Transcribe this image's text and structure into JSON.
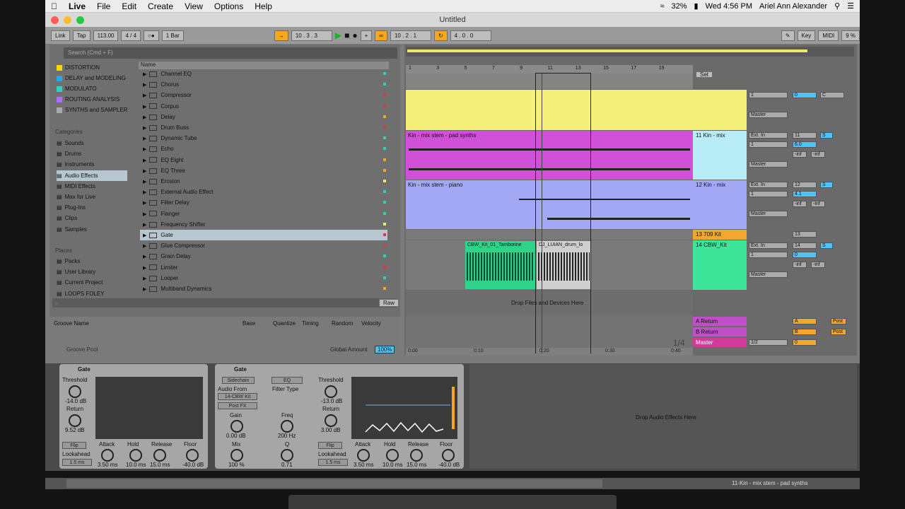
{
  "menubar": {
    "app": "Live",
    "items": [
      "File",
      "Edit",
      "Create",
      "View",
      "Options",
      "Help"
    ],
    "battery": "32%",
    "clock": "Wed 4:56 PM",
    "user": "Ariel Ann Alexander"
  },
  "window": {
    "title": "Untitled"
  },
  "transport": {
    "link": "Link",
    "tap": "Tap",
    "tempo": "113.00",
    "signature": "4 / 4",
    "quantize": "1 Bar",
    "position": "10 .  3 .  3",
    "loop_start": "10 .  2 .  1",
    "loop_length": "4 .  0 .  0",
    "key": "Key",
    "midi": "MIDI",
    "cpu": "9 %"
  },
  "browser": {
    "search_placeholder": "Search (Cmd + F)",
    "collections": [
      {
        "label": "DISTORTION",
        "color": "#f5d800"
      },
      {
        "label": "DELAY and MODELING",
        "color": "#29a7e0"
      },
      {
        "label": "MODULATO",
        "color": "#2ed0c0"
      },
      {
        "label": "ROUTING ANALYSIS",
        "color": "#b06cff"
      },
      {
        "label": "SYNTHS and SAMPLER",
        "color": "#aaaaaa"
      }
    ],
    "categories_header": "Categories",
    "categories": [
      "Sounds",
      "Drums",
      "Instruments",
      "Audio Effects",
      "MIDI Effects",
      "Max for Live",
      "Plug-Ins",
      "Clips",
      "Samples"
    ],
    "places_header": "Places",
    "places": [
      "Packs",
      "User Library",
      "Current Project",
      "LOOPS FOLEY"
    ],
    "name_header": "Name",
    "items": [
      "Channel EQ",
      "Chorus",
      "Compressor",
      "Corpus",
      "Delay",
      "Drum Buss",
      "Dynamic Tube",
      "Echo",
      "EQ Eight",
      "EQ Three",
      "Erosion",
      "External Audio Effect",
      "Filter Delay",
      "Flanger",
      "Frequency Shifter",
      "Gate",
      "Glue Compressor",
      "Grain Delay",
      "Limiter",
      "Looper",
      "Multiband Dynamics"
    ],
    "raw": "Raw"
  },
  "groove": {
    "columns": [
      "Groove Name",
      "Base",
      "Quantize",
      "Timing",
      "Random",
      "Velocity"
    ],
    "pool": "Groove Pool",
    "global_amount_label": "Global Amount",
    "global_amount": "100%"
  },
  "arrangement": {
    "ruler": [
      "1",
      "3",
      "5",
      "7",
      "9",
      "11",
      "13",
      "15",
      "17",
      "19"
    ],
    "time": [
      "0:00",
      "0:10",
      "0:20",
      "0:30",
      "0:40"
    ],
    "set": "Set",
    "zoom": "1/4",
    "drop_hint": "Drop Files and Devices Here",
    "clips": {
      "pad": "Kin - mix stem - pad synths",
      "piano": "Kin - mix stem - piano",
      "tamb": "CBW_Kit_01_Tamborine",
      "drum": "DJ_LUIAN_drum_lo"
    },
    "tracks": [
      {
        "name": "11 Kin - mix",
        "num": "11",
        "vol": "6.0",
        "input": "Ext. In",
        "ch": "1",
        "out": "Master"
      },
      {
        "name": "12 Kin - mix",
        "num": "12",
        "vol": "4.1",
        "input": "Ext. In",
        "ch": "1",
        "out": "Master"
      },
      {
        "name": "13 709 Kit",
        "num": "13"
      },
      {
        "name": "14 CBW_Kit",
        "num": "14",
        "vol": "0",
        "input": "Ext. In",
        "ch": "1",
        "out": "Master"
      }
    ],
    "first": {
      "ch": "1",
      "vol": "0",
      "pan": "C",
      "out": "Master"
    },
    "returns": [
      {
        "name": "A Return",
        "send": "A"
      },
      {
        "name": "B Return",
        "send": "B"
      },
      {
        "name": "Master",
        "send": "0"
      }
    ],
    "master_out": "1/2",
    "inf": "-inf",
    "in_auto_off": [
      "In",
      "Auto",
      "Off"
    ],
    "post": "Post",
    "s": "S"
  },
  "devices": {
    "gate1": {
      "title": "Gate",
      "threshold_label": "Threshold",
      "threshold": "-14.0 dB",
      "return_label": "Return",
      "return_val": "9.52 dB",
      "flip": "Flip",
      "lookahead": "Lookahead",
      "lookahead_val": "1.5 ms",
      "attack": "3.50 ms",
      "hold": "10.0 ms",
      "release": "15.0 ms",
      "floor": "-40.0 dB",
      "scale": [
        "+6",
        "0",
        "-6",
        "-12",
        "-18",
        "-36",
        "-70"
      ]
    },
    "gate2": {
      "title": "Gate",
      "sidechain": "Sidechain",
      "eq": "EQ",
      "audio_from": "Audio From",
      "source": "14-CBW Kit",
      "post": "Post FX",
      "filter_type": "Filter Type",
      "gain_label": "Gain",
      "gain": "0.00 dB",
      "freq_label": "Freq",
      "freq": "200 Hz",
      "mix_label": "Mix",
      "mix": "100 %",
      "q_label": "Q",
      "q": "0.71",
      "threshold_label": "Threshold",
      "threshold": "-13.0 dB",
      "return_label": "Return",
      "return_val": "3.00 dB",
      "flip": "Flip",
      "lookahead": "Lookahead",
      "lookahead_val": "1.5 ms",
      "attack": "3.50 ms",
      "hold": "10.0 ms",
      "release": "15.0 ms",
      "floor": "-40.0 dB"
    },
    "drop_hint": "Drop Audio Effects Here",
    "knob_labels": [
      "Attack",
      "Hold",
      "Release",
      "Floor"
    ]
  },
  "status": {
    "track": "11-Kin - mix stem - pad synths"
  }
}
